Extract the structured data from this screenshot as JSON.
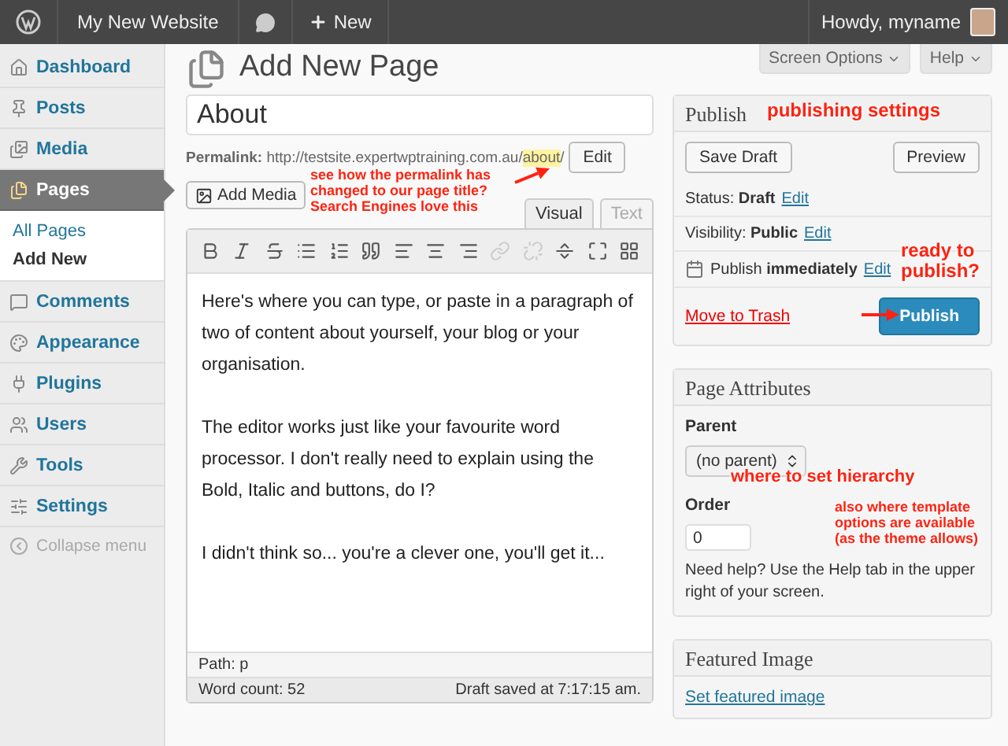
{
  "admin_bar": {
    "site": "My New Website",
    "new": "New",
    "greeting": "Howdy, myname"
  },
  "sidebar": {
    "items": [
      {
        "label": "Dashboard",
        "selected": false
      },
      {
        "label": "Posts",
        "selected": false
      },
      {
        "label": "Media",
        "selected": false
      },
      {
        "label": "Pages",
        "selected": true,
        "children": [
          {
            "label": "All Pages",
            "selected": false
          },
          {
            "label": "Add New",
            "selected": true
          }
        ]
      },
      {
        "label": "Comments",
        "selected": false
      },
      {
        "label": "Appearance",
        "selected": false
      },
      {
        "label": "Plugins",
        "selected": false
      },
      {
        "label": "Users",
        "selected": false
      },
      {
        "label": "Tools",
        "selected": false
      },
      {
        "label": "Settings",
        "selected": false
      }
    ],
    "collapse": "Collapse menu"
  },
  "header": {
    "title": "Add New Page",
    "screen_options": "Screen Options",
    "help": "Help"
  },
  "editor": {
    "title_value": "About",
    "permalink_label": "Permalink:",
    "permalink_url": "http://testsite.expertwptraining.com.au/",
    "permalink_slug": "about",
    "permalink_end": "/",
    "edit": "Edit",
    "add_media": "Add Media",
    "tabs": [
      {
        "label": "Visual",
        "selected": true
      },
      {
        "label": "Text",
        "selected": false
      }
    ],
    "toolbar": [
      {
        "disabled": false
      },
      {
        "disabled": false
      },
      {
        "disabled": false
      },
      {
        "disabled": false
      },
      {
        "disabled": false
      },
      {
        "disabled": false
      },
      {
        "disabled": false
      },
      {
        "disabled": false
      },
      {
        "disabled": false
      },
      {
        "disabled": true
      },
      {
        "disabled": true
      },
      {
        "disabled": false
      },
      {
        "disabled": false
      },
      {
        "disabled": false
      }
    ],
    "paragraphs": [
      "Here's where you can type, or paste in a paragraph of two of content about yourself, your blog or your organisation.",
      "The editor works just like your favourite word processor.  I don't really need to explain using the Bold, Italic and buttons, do I?",
      "I didn't think so... you're a clever one, you'll get it..."
    ],
    "path": "Path: p",
    "word_count": "Word count: 52",
    "draft_saved": "Draft saved at 7:17:15 am."
  },
  "publish": {
    "title": "Publish",
    "save_draft": "Save Draft",
    "preview": "Preview",
    "rows": [
      {
        "kind": "status",
        "label": "Status:",
        "value": "Draft",
        "edit": "Edit"
      },
      {
        "kind": "visibility",
        "label": "Visibility:",
        "value": "Public",
        "edit": "Edit"
      },
      {
        "kind": "schedule",
        "label": "Publish",
        "value": "immediately",
        "edit": "Edit"
      }
    ],
    "trash": "Move to Trash",
    "publish": "Publish"
  },
  "page_attributes": {
    "title": "Page Attributes",
    "parent_label": "Parent",
    "parent_value": "(no parent)",
    "order_label": "Order",
    "order_value": "0",
    "help": "Need help? Use the Help tab in the upper right of your screen."
  },
  "featured_image": {
    "title": "Featured Image",
    "link": "Set featured image"
  },
  "annotations": [
    {
      "kind": "permalink",
      "text": "see how the permalink has changed to our page title? Search Engines love this"
    },
    {
      "kind": "publish_box",
      "text": "publishing settings"
    },
    {
      "kind": "publish_button",
      "text": "ready to publish?"
    },
    {
      "kind": "hierarchy",
      "text": "where to set hierarchy"
    },
    {
      "kind": "template",
      "text": "also where template options are available (as the theme allows)"
    }
  ]
}
